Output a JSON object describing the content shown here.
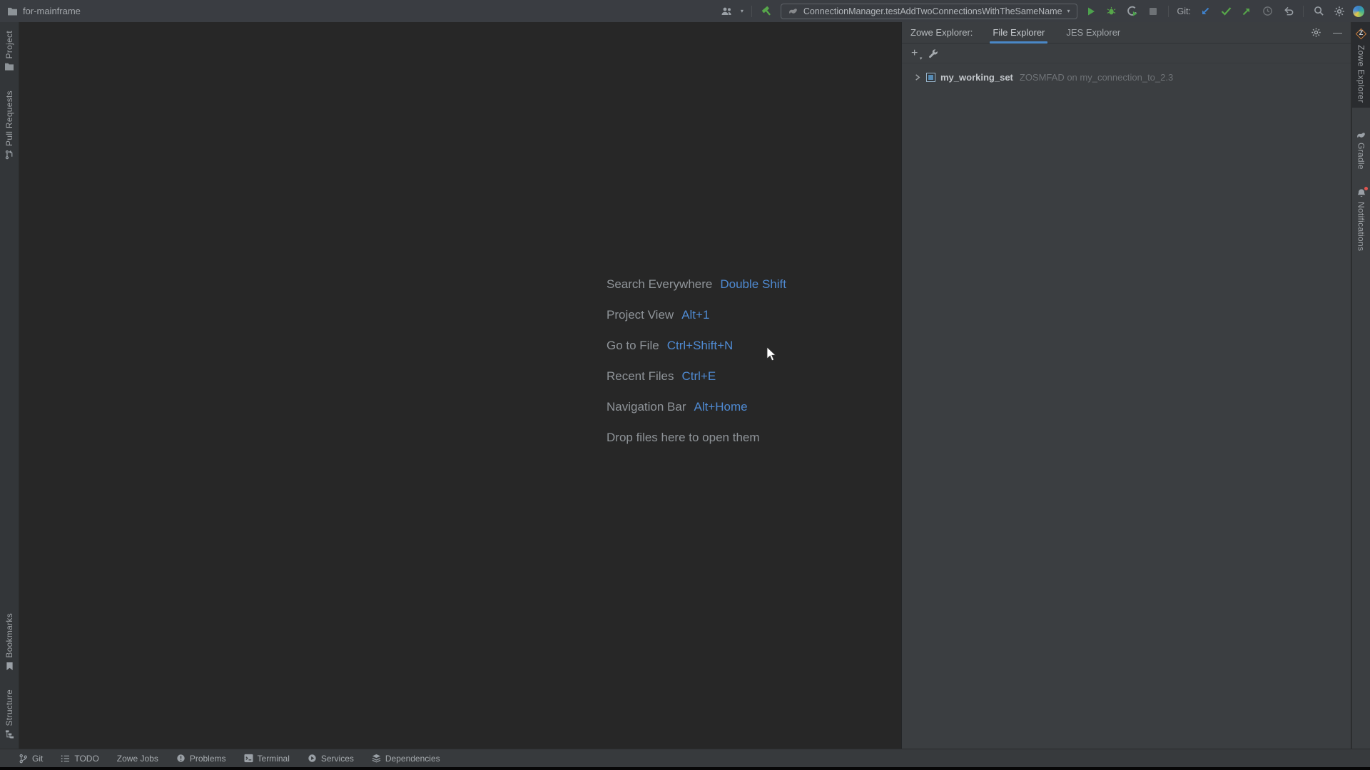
{
  "titlebar": {
    "project_name": "for-mainframe",
    "run_config": "ConnectionManager.testAddTwoConnectionsWithTheSameName",
    "git_label": "Git:"
  },
  "left_stripe": {
    "project": "Project",
    "pull_requests": "Pull Requests",
    "bookmarks": "Bookmarks",
    "structure": "Structure"
  },
  "editor": {
    "shortcuts": [
      {
        "action": "Search Everywhere",
        "keys": "Double Shift"
      },
      {
        "action": "Project View",
        "keys": "Alt+1"
      },
      {
        "action": "Go to File",
        "keys": "Ctrl+Shift+N"
      },
      {
        "action": "Recent Files",
        "keys": "Ctrl+E"
      },
      {
        "action": "Navigation Bar",
        "keys": "Alt+Home"
      }
    ],
    "drop_hint": "Drop files here to open them"
  },
  "zowe_panel": {
    "title": "Zowe Explorer:",
    "tabs": [
      {
        "label": "File Explorer",
        "selected": true
      },
      {
        "label": "JES Explorer",
        "selected": false
      }
    ],
    "tree_item": {
      "name": "my_working_set",
      "detail": "ZOSMFAD on my_connection_to_2.3"
    }
  },
  "right_stripe": {
    "zowe": "Zowe Explorer",
    "gradle": "Gradle",
    "notifications": "Notifications"
  },
  "status_bar": {
    "items": [
      "Git",
      "TODO",
      "Zowe Jobs",
      "Problems",
      "Terminal",
      "Services",
      "Dependencies"
    ]
  },
  "icons": {
    "caret_glyph": "▾",
    "plus_glyph": "+",
    "minus_glyph": "—",
    "zowe_letter": "Z"
  },
  "colors": {
    "accent_blue": "#4a88c7",
    "shortcut_blue": "#4f8ad2",
    "run_green": "#57a64a",
    "update_blue": "#3f82cc",
    "titlebar_bg": "#3a3d42",
    "editor_bg": "#272727",
    "panel_bg": "#3b3e41",
    "notification_red": "#e0544f"
  }
}
